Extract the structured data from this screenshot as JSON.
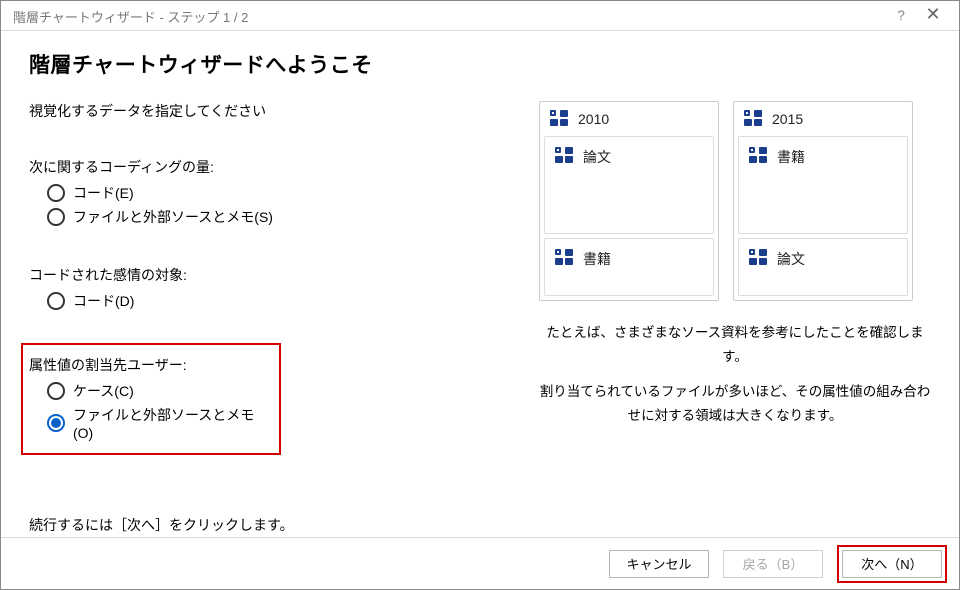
{
  "titlebar": {
    "title": "階層チャートウィザード - ステップ 1 / 2",
    "help": "?",
    "close": "✕"
  },
  "heading": "階層チャートウィザードへようこそ",
  "instruction": "視覚化するデータを指定してください",
  "group1": {
    "label": "次に関するコーディングの量:",
    "opt1": "コード(E)",
    "opt2": "ファイルと外部ソースとメモ(S)"
  },
  "group2": {
    "label": "コードされた感情の対象:",
    "opt1": "コード(D)"
  },
  "group3": {
    "label": "属性値の割当先ユーザー:",
    "opt1": "ケース(C)",
    "opt2": "ファイルと外部ソースとメモ(O)"
  },
  "continue_text": "続行するには［次へ］をクリックします。",
  "preview": {
    "col1_head": "2010",
    "col1_sub1": "論文",
    "col1_sub2": "書籍",
    "col2_head": "2015",
    "col2_sub1": "書籍",
    "col2_sub2": "論文"
  },
  "description": {
    "line1": "たとえば、さまざまなソース資料を参考にしたことを確認します。",
    "line2": "割り当てられているファイルが多いほど、その属性値の組み合わせに対する領域は大きくなります。"
  },
  "footer": {
    "cancel": "キャンセル",
    "back": "戻る（B）",
    "next": "次へ（N）"
  }
}
